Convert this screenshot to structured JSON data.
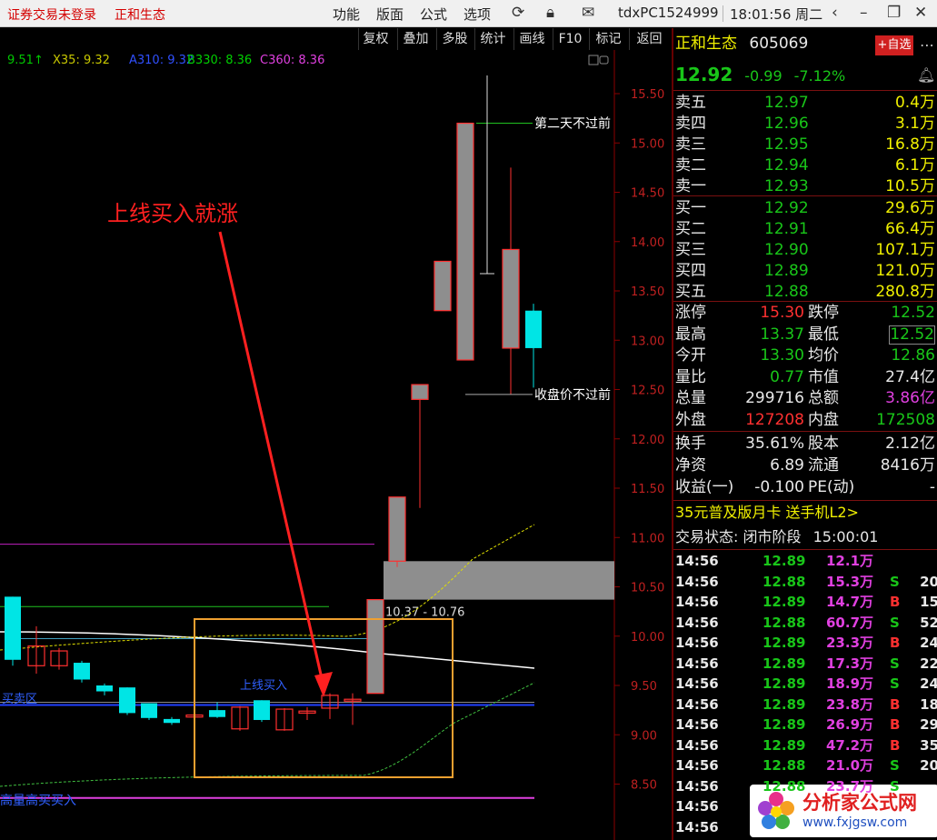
{
  "titlebar": {
    "trade_status": "证券交易未登录",
    "stock_name": "正和生态",
    "menu": [
      "功能",
      "版面",
      "公式",
      "选项"
    ],
    "account": "tdxPC1524999",
    "clock": "18:01:56 周二"
  },
  "toolbar": {
    "buttons": [
      "复权",
      "叠加",
      "多股",
      "统计",
      "画线",
      "F10",
      "标记",
      "返回"
    ]
  },
  "chart": {
    "legend": [
      {
        "text": "9.51↑",
        "color": "#00c800"
      },
      {
        "text": "X35: 9.32",
        "color": "#c8c800"
      },
      {
        "text": "A310: 9.32",
        "color": "#3050ff"
      },
      {
        "text": "B330: 8.36",
        "color": "#00d000"
      },
      {
        "text": "C360: 8.36",
        "color": "#e040e0"
      }
    ],
    "y_ticks": [
      "15.50",
      "15.00",
      "14.50",
      "14.00",
      "13.50",
      "13.00",
      "12.50",
      "12.00",
      "11.50",
      "11.00",
      "10.50",
      "10.00",
      "9.50",
      "9.00",
      "8.50"
    ],
    "annotation_main": "上线买入就涨",
    "annotation_next_day": "第二天不过前",
    "annotation_close": "收盘价不过前",
    "range_label": "10.37 - 10.76",
    "buy_line_label": "上线买入",
    "left_label": "买卖区",
    "bottom_label": "高量高买买入",
    "colors": {
      "up": "#ff3030",
      "down": "#00e5e5",
      "grid_axis": "#8b0000",
      "box": "#f0a030"
    }
  },
  "chart_data": {
    "type": "candlestick",
    "y_axis_ticks": [
      15.5,
      15.0,
      14.5,
      14.0,
      13.5,
      13.0,
      12.5,
      12.0,
      11.5,
      11.0,
      10.5,
      10.0,
      9.5,
      9.0,
      8.5
    ],
    "gap_zone": [
      10.37,
      10.76
    ],
    "candles": [
      {
        "open": 10.4,
        "close": 9.76,
        "high": 10.4,
        "low": 9.7,
        "dir": "down"
      },
      {
        "open": 9.7,
        "close": 9.9,
        "high": 10.1,
        "low": 9.62,
        "dir": "up"
      },
      {
        "open": 9.7,
        "close": 9.85,
        "high": 9.88,
        "low": 9.66,
        "dir": "up"
      },
      {
        "open": 9.73,
        "close": 9.56,
        "high": 9.75,
        "low": 9.53,
        "dir": "down"
      },
      {
        "open": 9.5,
        "close": 9.44,
        "high": 9.52,
        "low": 9.4,
        "dir": "down"
      },
      {
        "open": 9.48,
        "close": 9.22,
        "high": 9.48,
        "low": 9.2,
        "dir": "down"
      },
      {
        "open": 9.32,
        "close": 9.17,
        "high": 9.32,
        "low": 9.15,
        "dir": "down"
      },
      {
        "open": 9.16,
        "close": 9.12,
        "high": 9.18,
        "low": 9.1,
        "dir": "down"
      },
      {
        "open": 9.18,
        "close": 9.2,
        "high": 9.2,
        "low": 9.17,
        "dir": "up"
      },
      {
        "open": 9.25,
        "close": 9.18,
        "high": 9.33,
        "low": 9.17,
        "dir": "down"
      },
      {
        "open": 9.06,
        "close": 9.28,
        "high": 9.29,
        "low": 9.04,
        "dir": "up"
      },
      {
        "open": 9.35,
        "close": 9.15,
        "high": 9.35,
        "low": 9.13,
        "dir": "down"
      },
      {
        "open": 9.05,
        "close": 9.26,
        "high": 9.27,
        "low": 9.04,
        "dir": "up"
      },
      {
        "open": 9.22,
        "close": 9.24,
        "high": 9.28,
        "low": 9.15,
        "dir": "up"
      },
      {
        "open": 9.27,
        "close": 9.4,
        "high": 9.42,
        "low": 9.16,
        "dir": "up"
      },
      {
        "open": 9.35,
        "close": 9.36,
        "high": 9.42,
        "low": 9.1,
        "dir": "up"
      },
      {
        "open": 9.42,
        "close": 10.37,
        "high": 10.37,
        "low": 9.42,
        "dir": "up"
      },
      {
        "open": 10.76,
        "close": 11.41,
        "high": 11.41,
        "low": 10.7,
        "dir": "up"
      },
      {
        "open": 12.4,
        "close": 12.55,
        "high": 12.55,
        "low": 11.3,
        "dir": "up"
      },
      {
        "open": 13.3,
        "close": 13.8,
        "high": 13.8,
        "low": 13.3,
        "dir": "up"
      },
      {
        "open": 12.8,
        "close": 15.2,
        "high": 15.2,
        "low": 12.8,
        "dir": "up"
      },
      {
        "open": 12.92,
        "close": 13.92,
        "high": 14.75,
        "low": 12.45,
        "dir": "up"
      },
      {
        "open": 13.3,
        "close": 12.92,
        "high": 13.37,
        "low": 12.52,
        "dir": "down"
      }
    ]
  },
  "quote": {
    "name": "正和生态",
    "code": "605069",
    "add_fav": "+自选",
    "price": "12.92",
    "change": "-0.99",
    "change_pct": "-7.12%",
    "asks": [
      {
        "label": "卖五",
        "price": "12.97",
        "vol": "0.4万"
      },
      {
        "label": "卖四",
        "price": "12.96",
        "vol": "3.1万"
      },
      {
        "label": "卖三",
        "price": "12.95",
        "vol": "16.8万"
      },
      {
        "label": "卖二",
        "price": "12.94",
        "vol": "6.1万"
      },
      {
        "label": "卖一",
        "price": "12.93",
        "vol": "10.5万"
      }
    ],
    "bids": [
      {
        "label": "买一",
        "price": "12.92",
        "vol": "29.6万"
      },
      {
        "label": "买二",
        "price": "12.91",
        "vol": "66.4万"
      },
      {
        "label": "买三",
        "price": "12.90",
        "vol": "107.1万"
      },
      {
        "label": "买四",
        "price": "12.89",
        "vol": "121.0万"
      },
      {
        "label": "买五",
        "price": "12.88",
        "vol": "280.8万"
      }
    ],
    "stats": [
      {
        "l1": "涨停",
        "v1": "15.30",
        "c1": "c-red",
        "l2": "跌停",
        "v2": "12.52",
        "c2": "c-green"
      },
      {
        "l1": "最高",
        "v1": "13.37",
        "c1": "c-green",
        "l2": "最低",
        "v2": "12.52",
        "c2": "c-green"
      },
      {
        "l1": "今开",
        "v1": "13.30",
        "c1": "c-green",
        "l2": "均价",
        "v2": "12.86",
        "c2": "c-green"
      },
      {
        "l1": "量比",
        "v1": "0.77",
        "c1": "c-green",
        "l2": "市值",
        "v2": "27.4亿",
        "c2": "c-white"
      },
      {
        "l1": "总量",
        "v1": "299716",
        "c1": "c-white",
        "l2": "总额",
        "v2": "3.86亿",
        "c2": "c-mag"
      },
      {
        "l1": "外盘",
        "v1": "127208",
        "c1": "c-red",
        "l2": "内盘",
        "v2": "172508",
        "c2": "c-green"
      }
    ],
    "stats2": [
      {
        "l1": "换手",
        "v1": "35.61%",
        "l2": "股本",
        "v2": "2.12亿"
      },
      {
        "l1": "净资",
        "v1": "6.89",
        "l2": "流通",
        "v2": "8416万"
      },
      {
        "l1": "收益(一)",
        "v1": "-0.100",
        "l2": "PE(动)",
        "v2": "-"
      }
    ],
    "promo": "35元普及版月卡 送手机L2>",
    "trade_state_label": "交易状态:",
    "trade_state": "闭市阶段",
    "trade_time": "15:00:01",
    "ticks": [
      {
        "time": "14:56",
        "price": "12.89",
        "vol": "12.1万",
        "bs": "",
        "n": ""
      },
      {
        "time": "14:56",
        "price": "12.88",
        "vol": "15.3万",
        "bs": "S",
        "n": "20"
      },
      {
        "time": "14:56",
        "price": "12.89",
        "vol": "14.7万",
        "bs": "B",
        "n": "15"
      },
      {
        "time": "14:56",
        "price": "12.88",
        "vol": "60.7万",
        "bs": "S",
        "n": "52"
      },
      {
        "time": "14:56",
        "price": "12.89",
        "vol": "23.3万",
        "bs": "B",
        "n": "24"
      },
      {
        "time": "14:56",
        "price": "12.89",
        "vol": "17.3万",
        "bs": "S",
        "n": "22"
      },
      {
        "time": "14:56",
        "price": "12.89",
        "vol": "18.9万",
        "bs": "S",
        "n": "24"
      },
      {
        "time": "14:56",
        "price": "12.89",
        "vol": "23.8万",
        "bs": "B",
        "n": "18"
      },
      {
        "time": "14:56",
        "price": "12.89",
        "vol": "26.9万",
        "bs": "B",
        "n": "29"
      },
      {
        "time": "14:56",
        "price": "12.89",
        "vol": "47.2万",
        "bs": "B",
        "n": "35"
      },
      {
        "time": "14:56",
        "price": "12.88",
        "vol": "21.0万",
        "bs": "S",
        "n": "20"
      },
      {
        "time": "14:56",
        "price": "12.88",
        "vol": "23.7万",
        "bs": "S",
        "n": ""
      },
      {
        "time": "14:56",
        "price": "",
        "vol": "",
        "bs": "",
        "n": ""
      },
      {
        "time": "14:56",
        "price": "",
        "vol": "",
        "bs": "",
        "n": ""
      }
    ]
  },
  "watermark": {
    "title": "分析家公式网",
    "url": "www.fxjgsw.com"
  }
}
